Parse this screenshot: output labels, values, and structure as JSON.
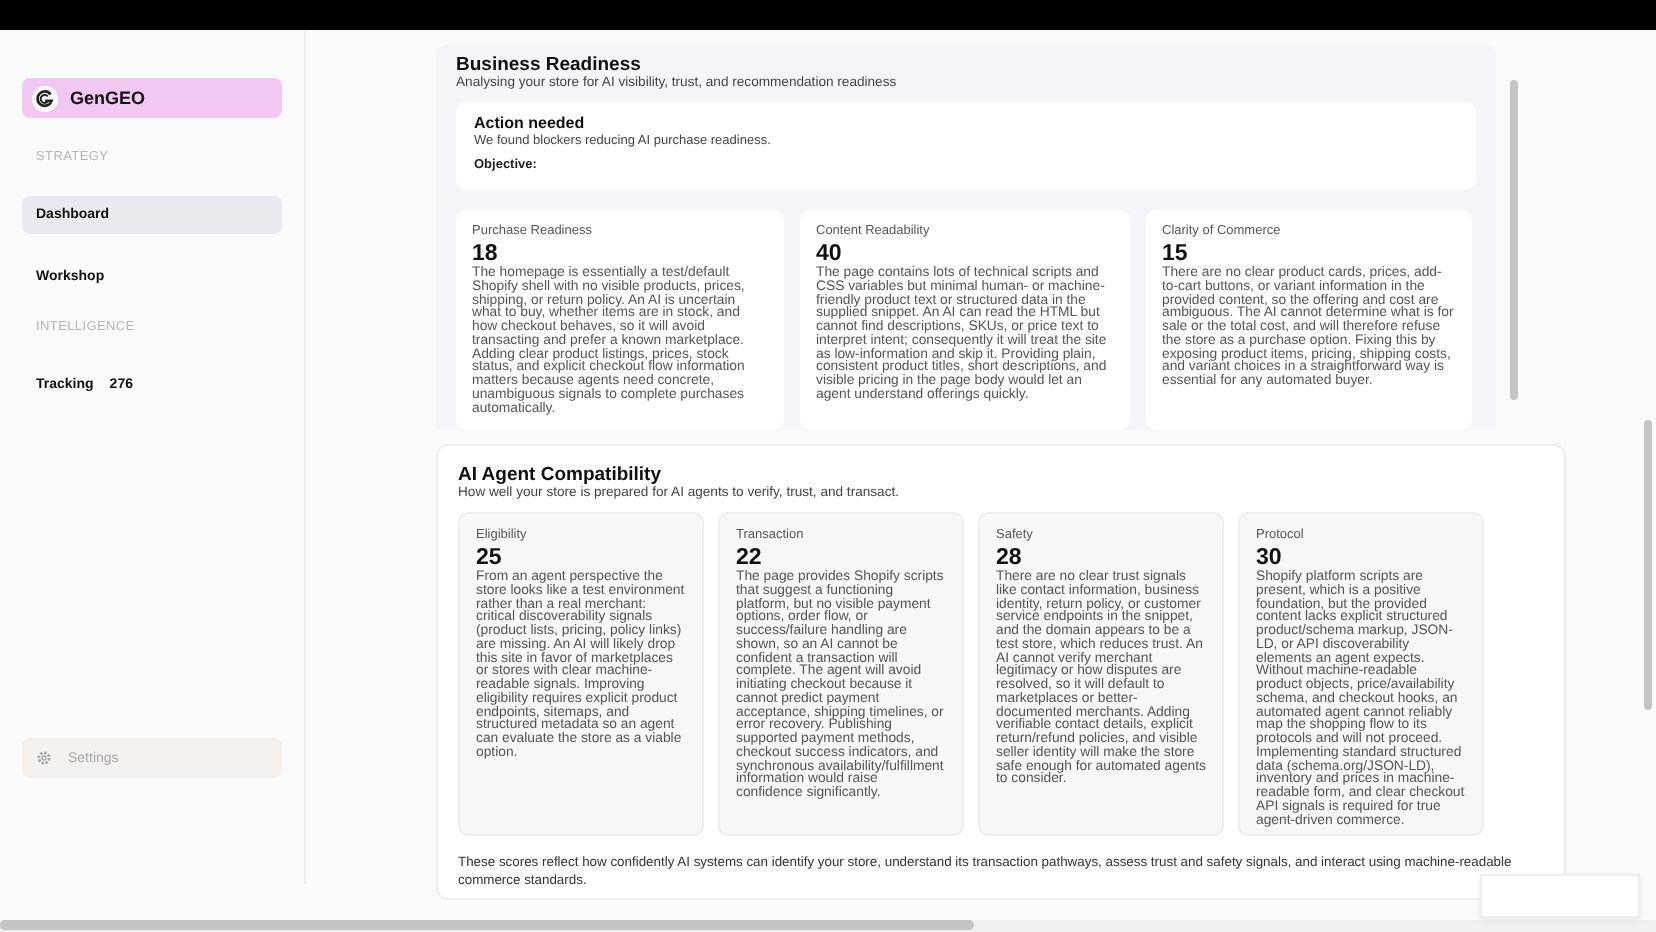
{
  "brand": {
    "name": "GenGEO"
  },
  "sidebar": {
    "sections": [
      {
        "heading": "STRATEGY",
        "items": [
          {
            "label": "Dashboard",
            "selected": true
          },
          {
            "label": "Workshop",
            "selected": false
          }
        ]
      },
      {
        "heading": "INTELLIGENCE",
        "items": [
          {
            "label": "Tracking",
            "count": "276",
            "selected": false
          }
        ]
      }
    ],
    "settings": {
      "label": "Settings",
      "disabled": true
    }
  },
  "business_readiness": {
    "title": "Business Readiness",
    "subtitle": "Analysing your store for AI visibility, trust, and recommendation readiness",
    "action": {
      "title": "Action needed",
      "message": "We found blockers reducing AI purchase readiness.",
      "objective_label": "Objective:"
    },
    "scores": [
      {
        "label": "Purchase Readiness",
        "score": "18",
        "description": "The homepage is essentially a test/default Shopify shell with no visible products, prices, shipping, or return policy. An AI is uncertain what to buy, whether items are in stock, and how checkout behaves, so it will avoid transacting and prefer a known marketplace. Adding clear product listings, prices, stock status, and explicit checkout flow information matters because agents need concrete, unambiguous signals to complete purchases automatically."
      },
      {
        "label": "Content Readability",
        "score": "40",
        "description": "The page contains lots of technical scripts and CSS variables but minimal human- or machine-friendly product text or structured data in the supplied snippet. An AI can read the HTML but cannot find descriptions, SKUs, or price text to interpret intent; consequently it will treat the site as low-information and skip it. Providing plain, consistent product titles, short descriptions, and visible pricing in the page body would let an agent understand offerings quickly."
      },
      {
        "label": "Clarity of Commerce",
        "score": "15",
        "description": "There are no clear product cards, prices, add-to-cart buttons, or variant information in the provided content, so the offering and cost are ambiguous. The AI cannot determine what is for sale or the total cost, and will therefore refuse the store as a purchase option. Fixing this by exposing product items, pricing, shipping costs, and variant choices in a straightforward way is essential for any automated buyer."
      }
    ]
  },
  "agent_compatibility": {
    "title": "AI Agent Compatibility",
    "subtitle": "How well your store is prepared for AI agents to verify, trust, and transact.",
    "scores": [
      {
        "label": "Eligibility",
        "score": "25",
        "description": "From an agent perspective the store looks like a test environment rather than a real merchant: critical discoverability signals (product lists, pricing, policy links) are missing. An AI will likely drop this site in favor of marketplaces or stores with clear machine-readable signals. Improving eligibility requires explicit product endpoints, sitemaps, and structured metadata so an agent can evaluate the store as a viable option."
      },
      {
        "label": "Transaction",
        "score": "22",
        "description": "The page provides Shopify scripts that suggest a functioning platform, but no visible payment options, order flow, or success/failure handling are shown, so an AI cannot be confident a transaction will complete. The agent will avoid initiating checkout because it cannot predict payment acceptance, shipping timelines, or error recovery. Publishing supported payment methods, checkout success indicators, and synchronous availability/fulfillment information would raise confidence significantly."
      },
      {
        "label": "Safety",
        "score": "28",
        "description": "There are no clear trust signals like contact information, business identity, return policy, or customer service endpoints in the snippet, and the domain appears to be a test store, which reduces trust. An AI cannot verify merchant legitimacy or how disputes are resolved, so it will default to marketplaces or better-documented merchants. Adding verifiable contact details, explicit return/refund policies, and visible seller identity will make the store safe enough for automated agents to consider."
      },
      {
        "label": "Protocol",
        "score": "30",
        "description": "Shopify platform scripts are present, which is a positive foundation, but the provided content lacks explicit structured product/schema markup, JSON-LD, or API discoverability elements an agent expects. Without machine-readable product objects, price/availability schema, and checkout hooks, an automated agent cannot reliably map the shopping flow to its protocols and will not proceed. Implementing standard structured data (schema.org/JSON-LD), inventory and prices in machine-readable form, and clear checkout API signals is required for true agent-driven commerce."
      }
    ],
    "footer": "These scores reflect how confidently AI systems can identify your store, understand its transaction pathways, assess trust and safety signals, and interact using machine-readable commerce standards."
  }
}
